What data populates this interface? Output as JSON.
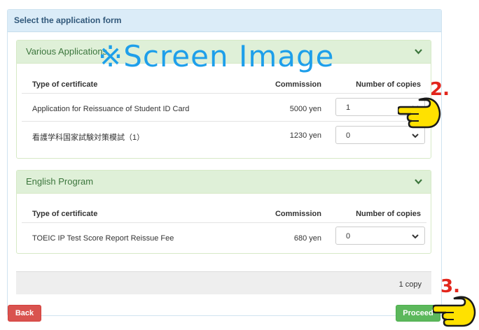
{
  "form": {
    "title": "Select the application form",
    "panels": [
      {
        "title": "Various Applications",
        "headers": {
          "type": "Type of certificate",
          "commission": "Commission",
          "copies": "Number of copies"
        },
        "rows": [
          {
            "type": "Application for Reissuance of Student ID Card",
            "commission": "5000 yen",
            "copies": "1"
          },
          {
            "type": "看護学科国家試験対策模試（1）",
            "commission": "1230 yen",
            "copies": "0"
          }
        ]
      },
      {
        "title": "English Program",
        "headers": {
          "type": "Type of certificate",
          "commission": "Commission",
          "copies": "Number of copies"
        },
        "rows": [
          {
            "type": "TOEIC IP Test Score Report Reissue Fee",
            "commission": "680 yen",
            "copies": "0"
          }
        ]
      }
    ],
    "summary": "1 copy",
    "back_label": "Back",
    "proceed_label": "Proceed"
  },
  "overlay": {
    "watermark": "※Screen Image",
    "step2": "2.",
    "step3": "3."
  },
  "colors": {
    "panel_green": "#dff0d8",
    "header_blue": "#dbecf8",
    "back_red": "#d9534f",
    "proceed_green": "#5cb85c",
    "watermark_blue": "#1e9fea",
    "step_red": "#e2261c",
    "hand_yellow": "#ffe100"
  },
  "icons": {
    "chevron": "chevron-down-icon",
    "hand": "pointing-hand-icon"
  }
}
